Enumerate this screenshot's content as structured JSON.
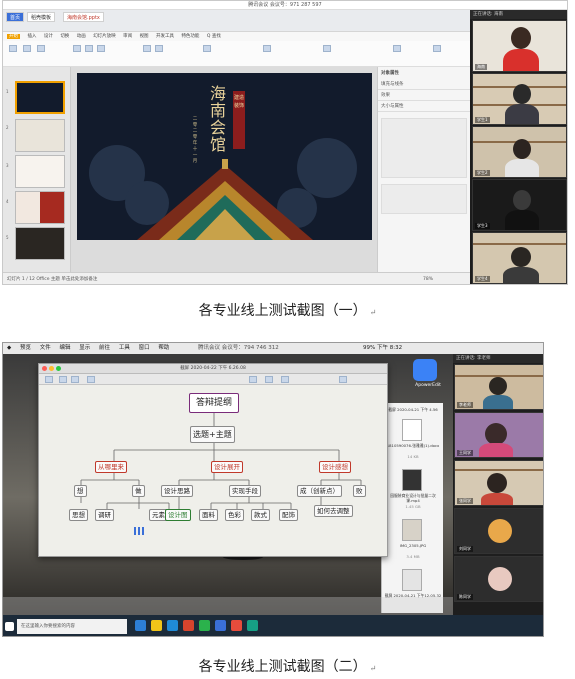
{
  "screenshot1": {
    "meeting_bar": "腾讯会议  会议号：971 287 597",
    "app_tabs": [
      "首页",
      "稻壳模板",
      "海南会馆.pptx"
    ],
    "ribbon_tabs": [
      "开始",
      "插入",
      "设计",
      "切换",
      "动画",
      "幻灯片放映",
      "审阅",
      "视图",
      "开发工具",
      "特色功能",
      "Q 查找"
    ],
    "slide": {
      "title": "海南会馆",
      "plaque": "建造装饰",
      "subtitle": "二零二零年十一月"
    },
    "right_panel": {
      "title": "对象属性",
      "items": [
        "填充与线条",
        "效果",
        "大小与属性"
      ]
    },
    "status_bar": "幻灯片 1 / 12   Office 主题   单击此处添加备注",
    "zoom": "78%",
    "video_header": "正在讲话: 海南",
    "participants": [
      "海南",
      "学生1",
      "学生2",
      "学生3",
      "学生4",
      "学生5"
    ]
  },
  "caption1": "各专业线上测试截图（一）",
  "screenshot2": {
    "menubar": [
      "预览",
      "文件",
      "编辑",
      "显示",
      "前往",
      "工具",
      "窗口",
      "帮助"
    ],
    "menubar_right": "99%  下午 8:32",
    "meeting_bar": "腾讯会议  会议号：794 746 312",
    "window_title": "截屏 2020-04-22 下午 6.26.08",
    "mindmap": {
      "root": "答辩提纲",
      "main": "选题+主题",
      "branches": [
        {
          "label": "从哪里来",
          "children": [
            "想",
            "做"
          ],
          "leaves": [
            "思想",
            "调研",
            "元素提取"
          ]
        },
        {
          "label": "设计展开",
          "children": [
            "设计思路",
            "实现手段"
          ],
          "leaves": [
            "设计图",
            "面料",
            "色彩",
            "款式",
            "配饰"
          ]
        },
        {
          "label": "设计感想",
          "children": [
            "成（创新点）",
            "败"
          ],
          "leaves": [
            "如何去调整"
          ]
        }
      ]
    },
    "finder_files": [
      {
        "name": "1810590076-张雅雅(1).docx",
        "size": "14 KB"
      },
      {
        "name": "园服装商业设计与批量二次课.mp4",
        "size": "1.45 GB"
      },
      {
        "name": "IMG_2305.JPG",
        "size": "3.4 MB"
      },
      {
        "name": "截屏 2020-04-21 下午12.05.32",
        "size": ""
      }
    ],
    "finder_top_label": "截屏 2020-04-21 下午 4.56",
    "app_icon_label": "ApowerEdit",
    "taskbar_search": "在这里输入你要搜索的内容",
    "video_header": "正在讲话: 李老师",
    "participants": [
      "李老师",
      "王同学",
      "张同学",
      "刘同学",
      "陈同学"
    ]
  },
  "caption2": "各专业线上测试截图（二）",
  "return_mark": "↵",
  "colors": {
    "slide_bg": "#121b2c",
    "slide_gold": "#e8d29a",
    "plaque_red": "#8c1d1d",
    "branch_red": "#c0392b",
    "branch_green": "#2e7d32"
  }
}
